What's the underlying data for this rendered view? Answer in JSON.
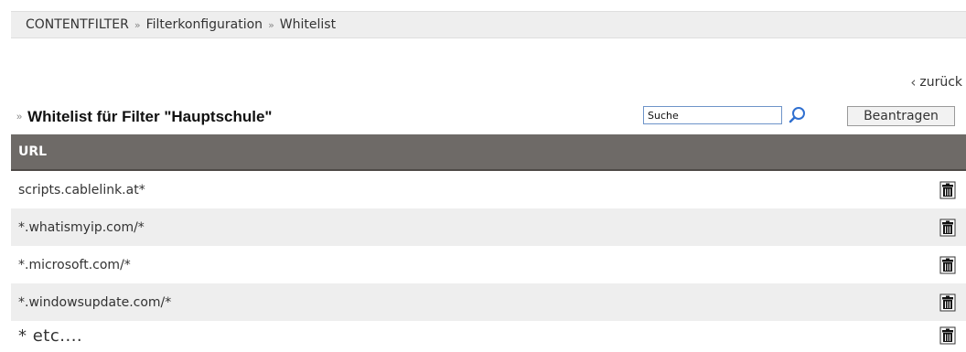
{
  "breadcrumb": {
    "items": [
      "CONTENTFILTER",
      "Filterkonfiguration",
      "Whitelist"
    ],
    "separator": "»"
  },
  "back_link": {
    "label": "zurück",
    "icon": "chevron-left-icon"
  },
  "section": {
    "title": "Whitelist für Filter \"Hauptschule\"",
    "arrow": "»"
  },
  "search": {
    "value": "Suche",
    "icon": "magnifier-icon"
  },
  "apply_button": {
    "label": "Beantragen"
  },
  "table": {
    "header": "URL",
    "rows": [
      {
        "url": "scripts.cablelink.at*"
      },
      {
        "url": "*.whatismyip.com/*"
      },
      {
        "url": "*.microsoft.com/*"
      },
      {
        "url": "*.windowsupdate.com/*"
      },
      {
        "url": "* etc...."
      }
    ],
    "row_action_icon": "trash-icon"
  },
  "colors": {
    "header_bg": "#6e6a67",
    "stripe_bg": "#eeeeee",
    "search_border": "#6e94c9",
    "search_icon": "#2f6fd0"
  }
}
